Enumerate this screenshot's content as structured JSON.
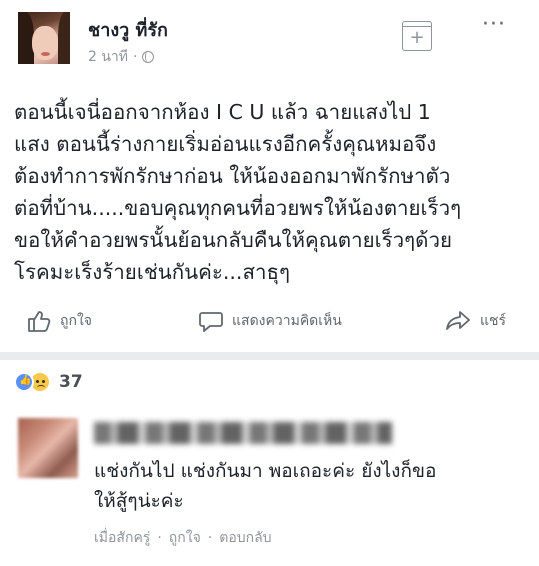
{
  "post": {
    "author": "ชางวู ที่รัก",
    "time": "2 นาที",
    "dot": "·",
    "text": "ตอนนี้เจนี่ออกจากห้อง I C U แล้ว ฉายแสงไป 1\nแสง ตอนนี้ร่างกายเริ่มอ่อนแรงอีกครั้งคุณหมอจึง\nต้องทำการพักรักษาก่อน ให้น้องออกมาพักรักษาตัว\nต่อที่บ้าน.....ขอบคุณทุกคนที่อวยพรให้น้องตายเร็วๆ\nขอให้คำอวยพรนั้นย้อนกลับคืนให้คุณตายเร็วๆด้วย\nโรคมะเร็งร้ายเช่นกันค่ะ...สาธุๆ",
    "more": "···",
    "plus": "+"
  },
  "actions": {
    "like": "ถูกใจ",
    "comment": "แสดงความคิดเห็น",
    "share": "แชร์"
  },
  "reactions": {
    "count": "37"
  },
  "comment": {
    "text": "แช่งกันไป แช่งกันมา พอเถอะค่ะ ยังไงก็ขอ\nให้สู้ๆน่ะค่ะ",
    "time": "เมื่อสักครู่",
    "dot": "·",
    "like": "ถูกใจ",
    "reply": "ตอบกลับ"
  }
}
